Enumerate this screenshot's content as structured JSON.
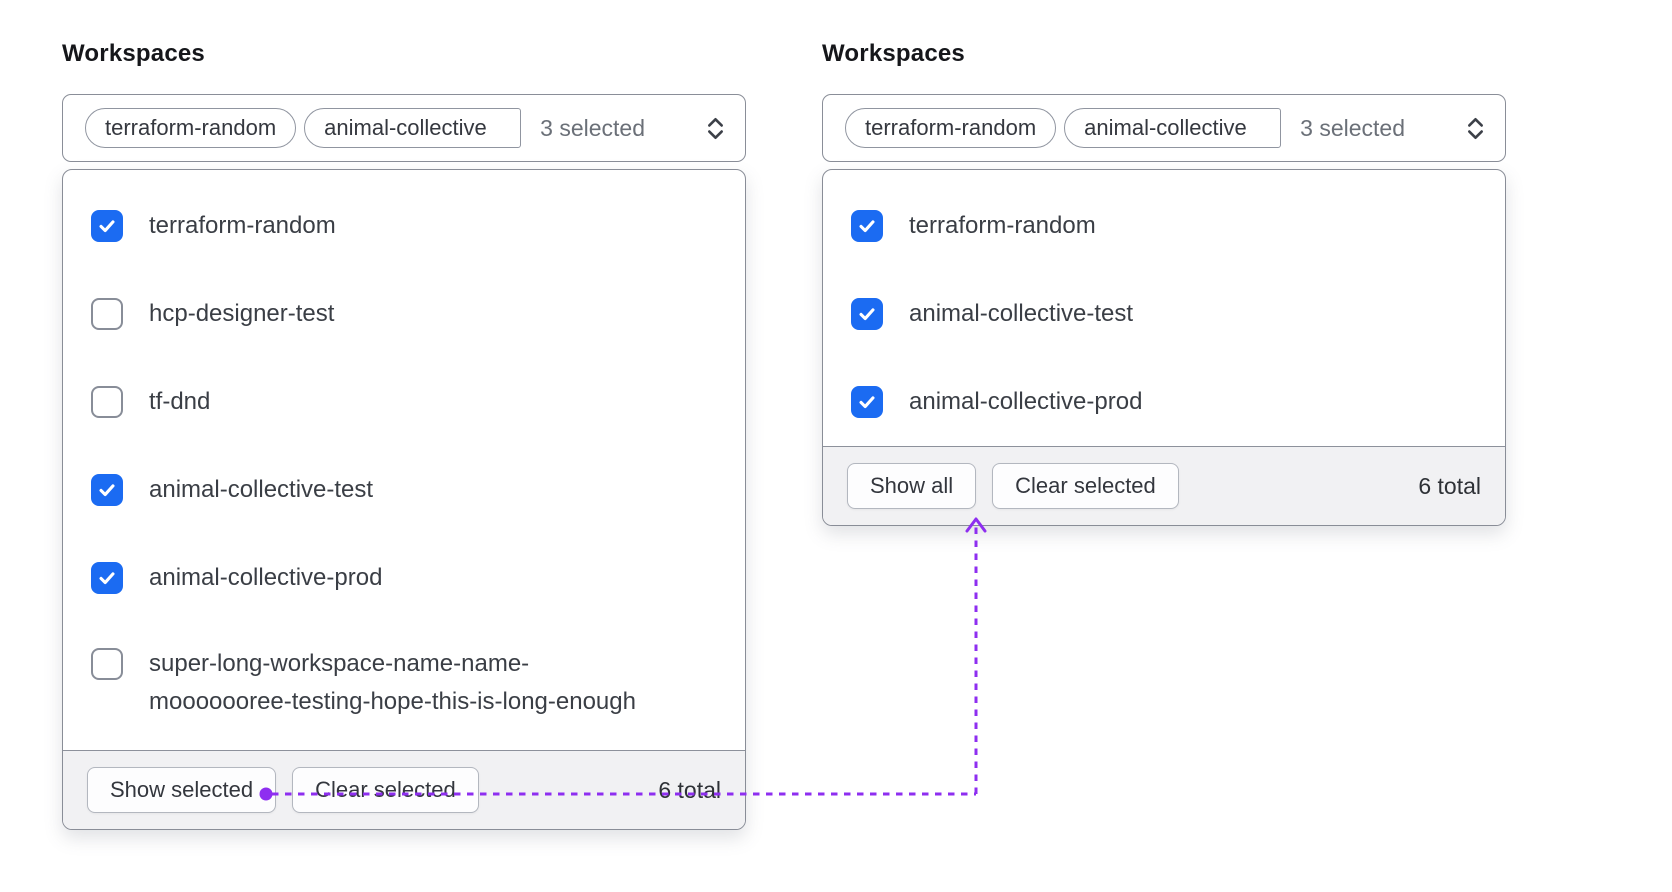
{
  "colors": {
    "checkbox_blue": "#1b6bf2",
    "connector_purple": "#8e2ef0"
  },
  "icons": {
    "select_chevron": "chevron-up-down",
    "checkbox_check": "check"
  },
  "left_panel": {
    "title": "Workspaces",
    "select": {
      "pill_1": "terraform-random",
      "pill_2": "animal-collective",
      "summary": "3 selected"
    },
    "items": [
      {
        "label": "terraform-random",
        "checked": true
      },
      {
        "label": "hcp-designer-test",
        "checked": false
      },
      {
        "label": "tf-dnd",
        "checked": false
      },
      {
        "label": "animal-collective-test",
        "checked": true
      },
      {
        "label": "animal-collective-prod",
        "checked": true
      },
      {
        "label": "super-long-workspace-name-name-\nmooooooree-testing-hope-this-is-long-enough",
        "checked": false
      }
    ],
    "footer": {
      "show_button": "Show selected",
      "clear_button": "Clear selected",
      "total": "6 total"
    }
  },
  "right_panel": {
    "title": "Workspaces",
    "select": {
      "pill_1": "terraform-random",
      "pill_2": "animal-collective",
      "summary": "3 selected"
    },
    "items": [
      {
        "label": "terraform-random",
        "checked": true
      },
      {
        "label": "animal-collective-test",
        "checked": true
      },
      {
        "label": "animal-collective-prod",
        "checked": true
      }
    ],
    "footer": {
      "show_button": "Show all",
      "clear_button": "Clear selected",
      "total": "6 total"
    }
  }
}
